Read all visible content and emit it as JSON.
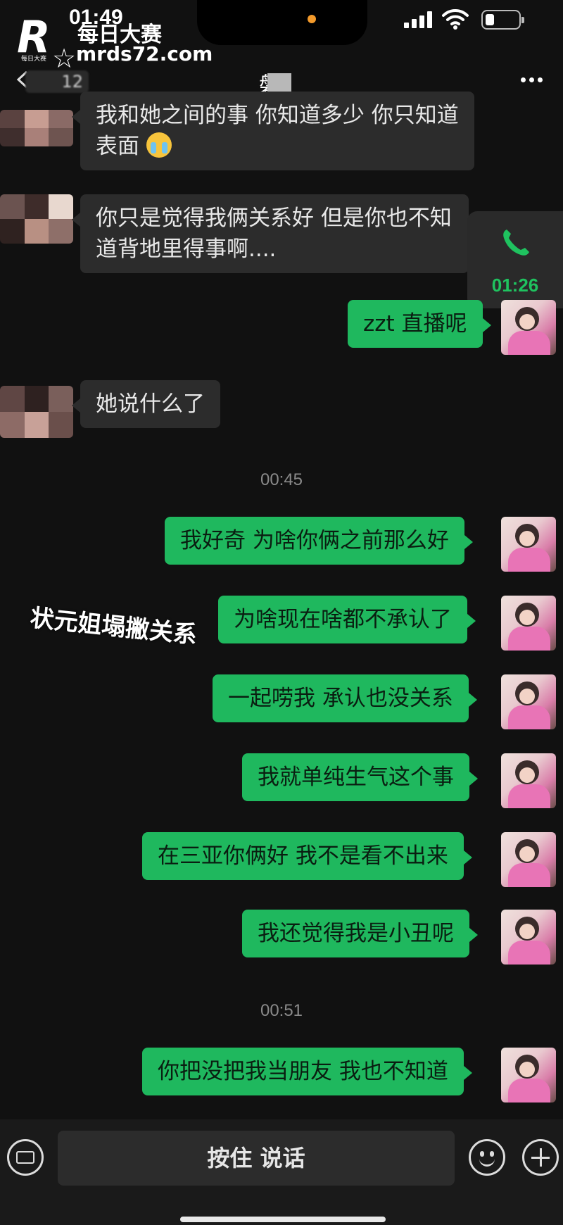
{
  "status_bar": {
    "time": "01:49"
  },
  "watermark": {
    "logo_letter": "R",
    "logo_caption": "每日大赛",
    "title": "每日大赛",
    "url": "mrds72.com"
  },
  "nav": {
    "unread_count": "12",
    "title": "磐"
  },
  "call_float": {
    "duration": "01:26",
    "accent": "#1fc25f"
  },
  "messages": [
    {
      "side": "in",
      "text": "我和她之间的事 你知道多少 你只知道表面"
    },
    {
      "side": "in",
      "text": "你只是觉得我俩关系好 但是你也不知道背地里得事啊...."
    },
    {
      "side": "out",
      "text": "zzt 直播呢"
    },
    {
      "side": "in",
      "text": "她说什么了"
    },
    {
      "side": "out",
      "text": "我好奇 为啥你俩之前那么好"
    },
    {
      "side": "out",
      "text": "为啥现在啥都不承认了"
    },
    {
      "side": "out",
      "text": "一起唠我 承认也没关系"
    },
    {
      "side": "out",
      "text": "我就单纯生气这个事"
    },
    {
      "side": "out",
      "text": "在三亚你俩好 我不是看不出来"
    },
    {
      "side": "out",
      "text": "我还觉得我是小丑呢"
    },
    {
      "side": "out",
      "text": "你把没把我当朋友 我也不知道"
    }
  ],
  "timestamps": [
    "00:45",
    "00:51"
  ],
  "overlay_caption": "状元姐塌撇关系",
  "input_bar": {
    "voice_label": "按住 说话"
  },
  "colors": {
    "background": "#111111",
    "outgoing_bubble": "#1fb85e",
    "incoming_bubble": "#2c2c2c"
  }
}
